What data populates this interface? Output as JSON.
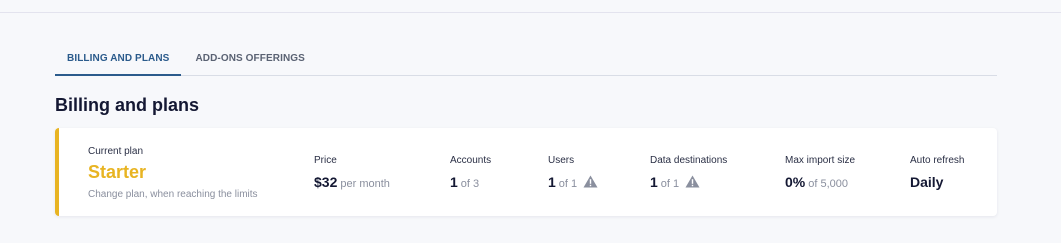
{
  "tabs": [
    {
      "label": "BILLING AND PLANS",
      "active": true
    },
    {
      "label": "ADD-ONS OFFERINGS",
      "active": false
    }
  ],
  "section_title": "Billing and plans",
  "colors": {
    "accent": "#e8b422",
    "tab_active": "#2b5b8c"
  },
  "plan": {
    "label": "Current plan",
    "name": "Starter",
    "hint": "Change plan, when reaching the limits"
  },
  "price": {
    "label": "Price",
    "value": "$32",
    "suffix": "per month"
  },
  "accounts": {
    "label": "Accounts",
    "value": "1",
    "suffix": "of 3"
  },
  "users": {
    "label": "Users",
    "value": "1",
    "suffix": "of 1",
    "icon": "warning-icon"
  },
  "data_destinations": {
    "label": "Data destinations",
    "value": "1",
    "suffix": "of 1",
    "icon": "warning-icon"
  },
  "max_import": {
    "label": "Max import size",
    "value": "0%",
    "suffix": "of 5,000"
  },
  "auto_refresh": {
    "label": "Auto refresh",
    "value": "Daily"
  }
}
